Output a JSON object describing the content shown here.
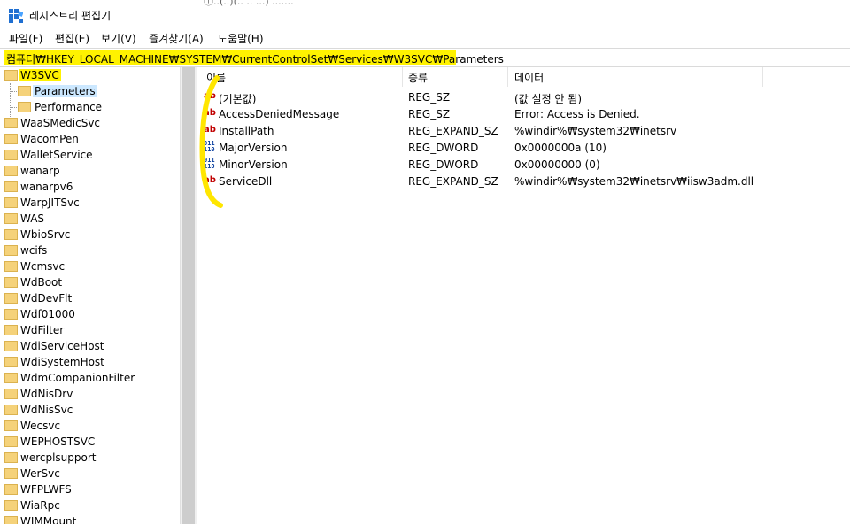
{
  "window": {
    "title": "레지스트리 편집기",
    "background_text": "ⓘ..(..)(.. .. ...) ......."
  },
  "menu": [
    {
      "label": "파일(F)"
    },
    {
      "label": "편집(E)"
    },
    {
      "label": "보기(V)"
    },
    {
      "label": "즐겨찾기(A)"
    },
    {
      "label": "도움말(H)"
    }
  ],
  "address": {
    "path": "컴퓨터₩HKEY_LOCAL_MACHINE₩SYSTEM₩CurrentControlSet₩Services₩W3SVC₩Parameters"
  },
  "tree": {
    "items": [
      {
        "label": "W3SVC",
        "highlight": true
      },
      {
        "label": "Parameters",
        "selected": true
      },
      {
        "label": "Performance"
      },
      {
        "label": "WaaSMedicSvc"
      },
      {
        "label": "WacomPen"
      },
      {
        "label": "WalletService"
      },
      {
        "label": "wanarp"
      },
      {
        "label": "wanarpv6"
      },
      {
        "label": "WarpJITSvc"
      },
      {
        "label": "WAS"
      },
      {
        "label": "WbioSrvc"
      },
      {
        "label": "wcifs"
      },
      {
        "label": "Wcmsvc"
      },
      {
        "label": "WdBoot"
      },
      {
        "label": "WdDevFlt"
      },
      {
        "label": "Wdf01000"
      },
      {
        "label": "WdFilter"
      },
      {
        "label": "WdiServiceHost"
      },
      {
        "label": "WdiSystemHost"
      },
      {
        "label": "WdmCompanionFilter"
      },
      {
        "label": "WdNisDrv"
      },
      {
        "label": "WdNisSvc"
      },
      {
        "label": "Wecsvc"
      },
      {
        "label": "WEPHOSTSVC"
      },
      {
        "label": "wercplsupport"
      },
      {
        "label": "WerSvc"
      },
      {
        "label": "WFPLWFS"
      },
      {
        "label": "WiaRpc"
      },
      {
        "label": "WIMMount"
      }
    ]
  },
  "columns": {
    "name": "이름",
    "type": "종류",
    "data": "데이터"
  },
  "values": [
    {
      "icon": "string-value-icon",
      "name": "(기본값)",
      "type": "REG_SZ",
      "data": "(값 설정 안 됨)"
    },
    {
      "icon": "string-value-icon",
      "name": "AccessDeniedMessage",
      "type": "REG_SZ",
      "data": "Error: Access is Denied."
    },
    {
      "icon": "string-value-icon",
      "name": "InstallPath",
      "type": "REG_EXPAND_SZ",
      "data": "%windir%₩system32₩inetsrv"
    },
    {
      "icon": "binary-value-icon",
      "name": "MajorVersion",
      "type": "REG_DWORD",
      "data": "0x0000000a (10)"
    },
    {
      "icon": "binary-value-icon",
      "name": "MinorVersion",
      "type": "REG_DWORD",
      "data": "0x00000000 (0)"
    },
    {
      "icon": "string-value-icon",
      "name": "ServiceDll",
      "type": "REG_EXPAND_SZ",
      "data": "%windir%₩system32₩inetsrv₩iisw3adm.dll"
    }
  ],
  "colors": {
    "highlight": "#fff200",
    "selection": "#cce8ff",
    "annotation": "#ffe600"
  }
}
